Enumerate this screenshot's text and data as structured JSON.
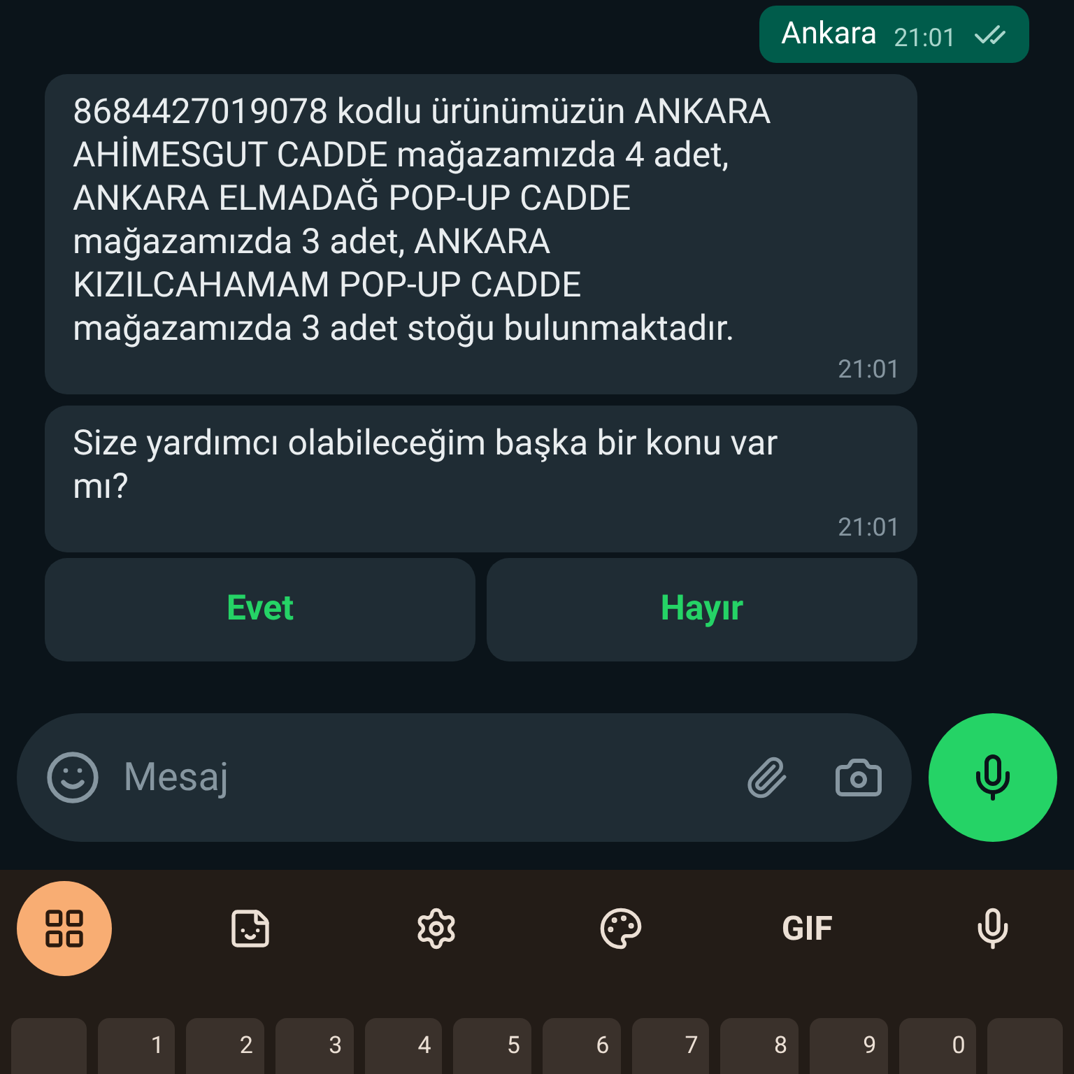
{
  "messages": [
    {
      "kind": "outgoing",
      "text": "Ankara",
      "time": "21:01",
      "read": true
    },
    {
      "kind": "incoming",
      "text": "8684427019078 kodlu ürünümüzün ANKARA AHİMESGUT CADDE mağazamızda 4 adet, ANKARA ELMADAĞ POP-UP CADDE mağazamızda 3 adet, ANKARA KIZILCAHAMAM POP-UP CADDE mağazamızda 3 adet stoğu bulunmaktadır.",
      "time": "21:01"
    },
    {
      "kind": "incoming",
      "text": "Size yardımcı olabileceğim başka bir konu var mı?",
      "time": "21:01"
    }
  ],
  "quick_replies": [
    "Evet",
    "Hayır"
  ],
  "composer": {
    "placeholder": "Mesaj"
  },
  "keyboard": {
    "toolbar": [
      {
        "kind": "apps",
        "selected": true
      },
      {
        "kind": "sticker",
        "selected": false
      },
      {
        "kind": "settings",
        "selected": false
      },
      {
        "kind": "palette",
        "selected": false
      },
      {
        "kind": "gif",
        "label": "GIF",
        "selected": false
      },
      {
        "kind": "mic",
        "selected": false
      }
    ],
    "number_keys": [
      "1",
      "2",
      "3",
      "4",
      "5",
      "6",
      "7",
      "8",
      "9",
      "0"
    ]
  }
}
